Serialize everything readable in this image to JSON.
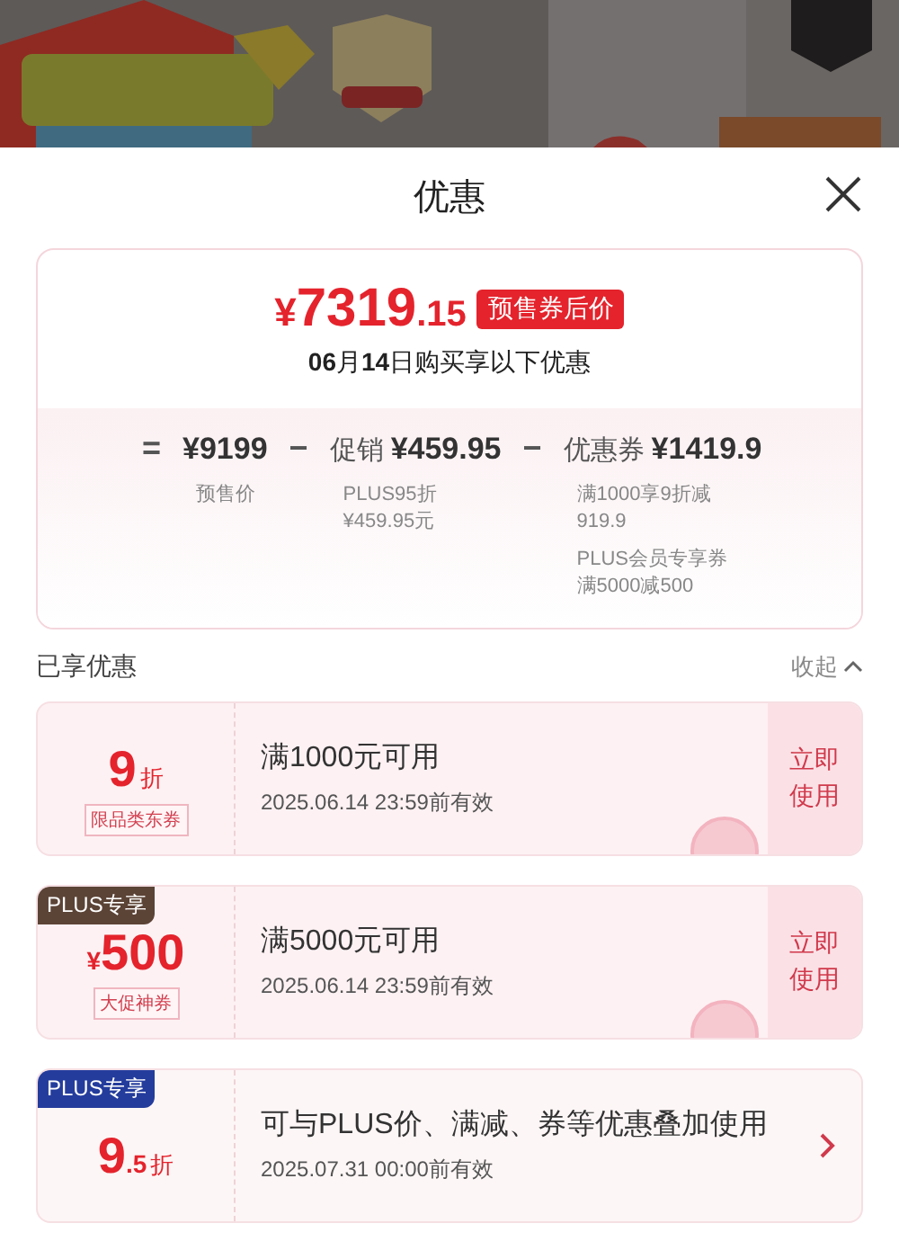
{
  "sheet": {
    "title": "优惠"
  },
  "summary": {
    "price": {
      "currency": "¥",
      "integer": "7319",
      "decimal": ".15",
      "tag": "预售券后价"
    },
    "date_line": "**06**月**14**日购买享以下优惠",
    "breakdown": [
      {
        "operator": "=",
        "amount": "¥9199",
        "notes": [
          [
            "预售价"
          ]
        ]
      },
      {
        "operator": "−",
        "label": "促销",
        "amount": "¥459.95",
        "notes": [
          [
            "PLUS95折",
            "¥459.95元"
          ]
        ]
      },
      {
        "operator": "−",
        "label": "优惠券",
        "amount": "¥1419.9",
        "notes": [
          [
            "满1000享9折减",
            "919.9"
          ],
          [
            "PLUS会员专享券",
            "满5000减500"
          ]
        ]
      }
    ]
  },
  "section": {
    "title": "已享优惠",
    "toggle": "收起",
    "expanded": true
  },
  "coupons": [
    {
      "amount": "9",
      "unit": "折",
      "tag": "限品类东券",
      "condition": "满1000元可用",
      "validity": "2025.06.14 23:59前有效",
      "action": {
        "kind": "button",
        "label": "立即使用"
      },
      "stamped": true
    },
    {
      "badge": {
        "text": "PLUS专享",
        "color": "#5b4336"
      },
      "currency": "¥",
      "amount": "500",
      "tag": "大促神券",
      "condition": "满5000元可用",
      "validity": "2025.06.14 23:59前有效",
      "action": {
        "kind": "button",
        "label": "立即使用"
      },
      "stamped": true
    },
    {
      "badge": {
        "text": "PLUS专享",
        "color": "#243c9c"
      },
      "amount": "9",
      "decimal": ".5",
      "unit": "折",
      "condition": "可与PLUS价、满减、券等优惠叠加使用",
      "validity": "2025.07.31 00:00前有效",
      "action": {
        "kind": "chevron"
      },
      "stamped": false
    }
  ]
}
